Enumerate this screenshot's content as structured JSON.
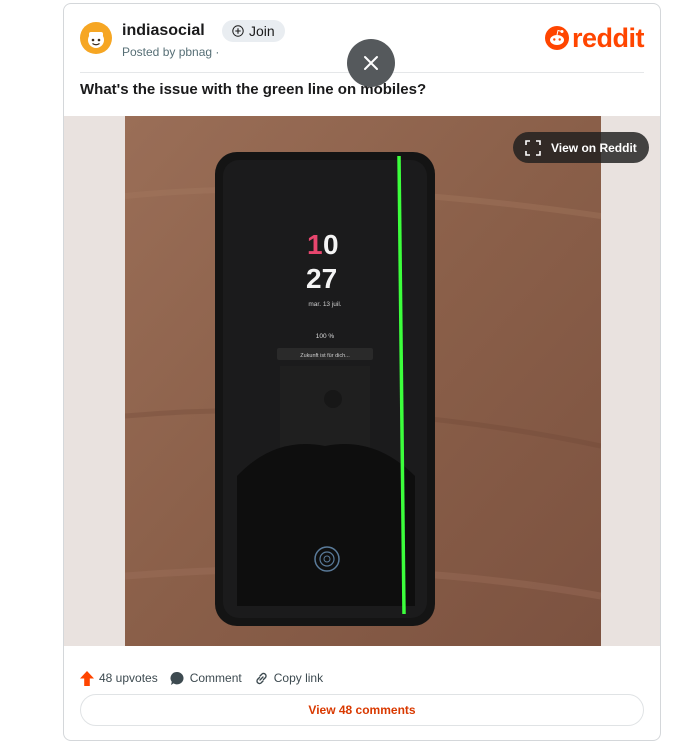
{
  "post": {
    "subreddit": "indiasocial",
    "join_label": "Join",
    "posted_by": "Posted by pbnag ·",
    "title": "What's the issue with the green line on mobiles?"
  },
  "brand": {
    "wordmark": "reddit",
    "color": "#ff4500"
  },
  "media": {
    "view_label": "View on Reddit",
    "screen_clock_hour": "10",
    "screen_clock_min": "27",
    "screen_date": "mar. 13 juil.",
    "screen_battery": "100 %",
    "screen_notice": "Zukunft ist für dich..."
  },
  "actions": {
    "upvotes": "48 upvotes",
    "comment": "Comment",
    "copy_link": "Copy link",
    "view_comments": "View 48 comments"
  },
  "colors": {
    "accent": "#ff4500",
    "upvote": "#ff4500",
    "green_line": "#3cff3c"
  }
}
